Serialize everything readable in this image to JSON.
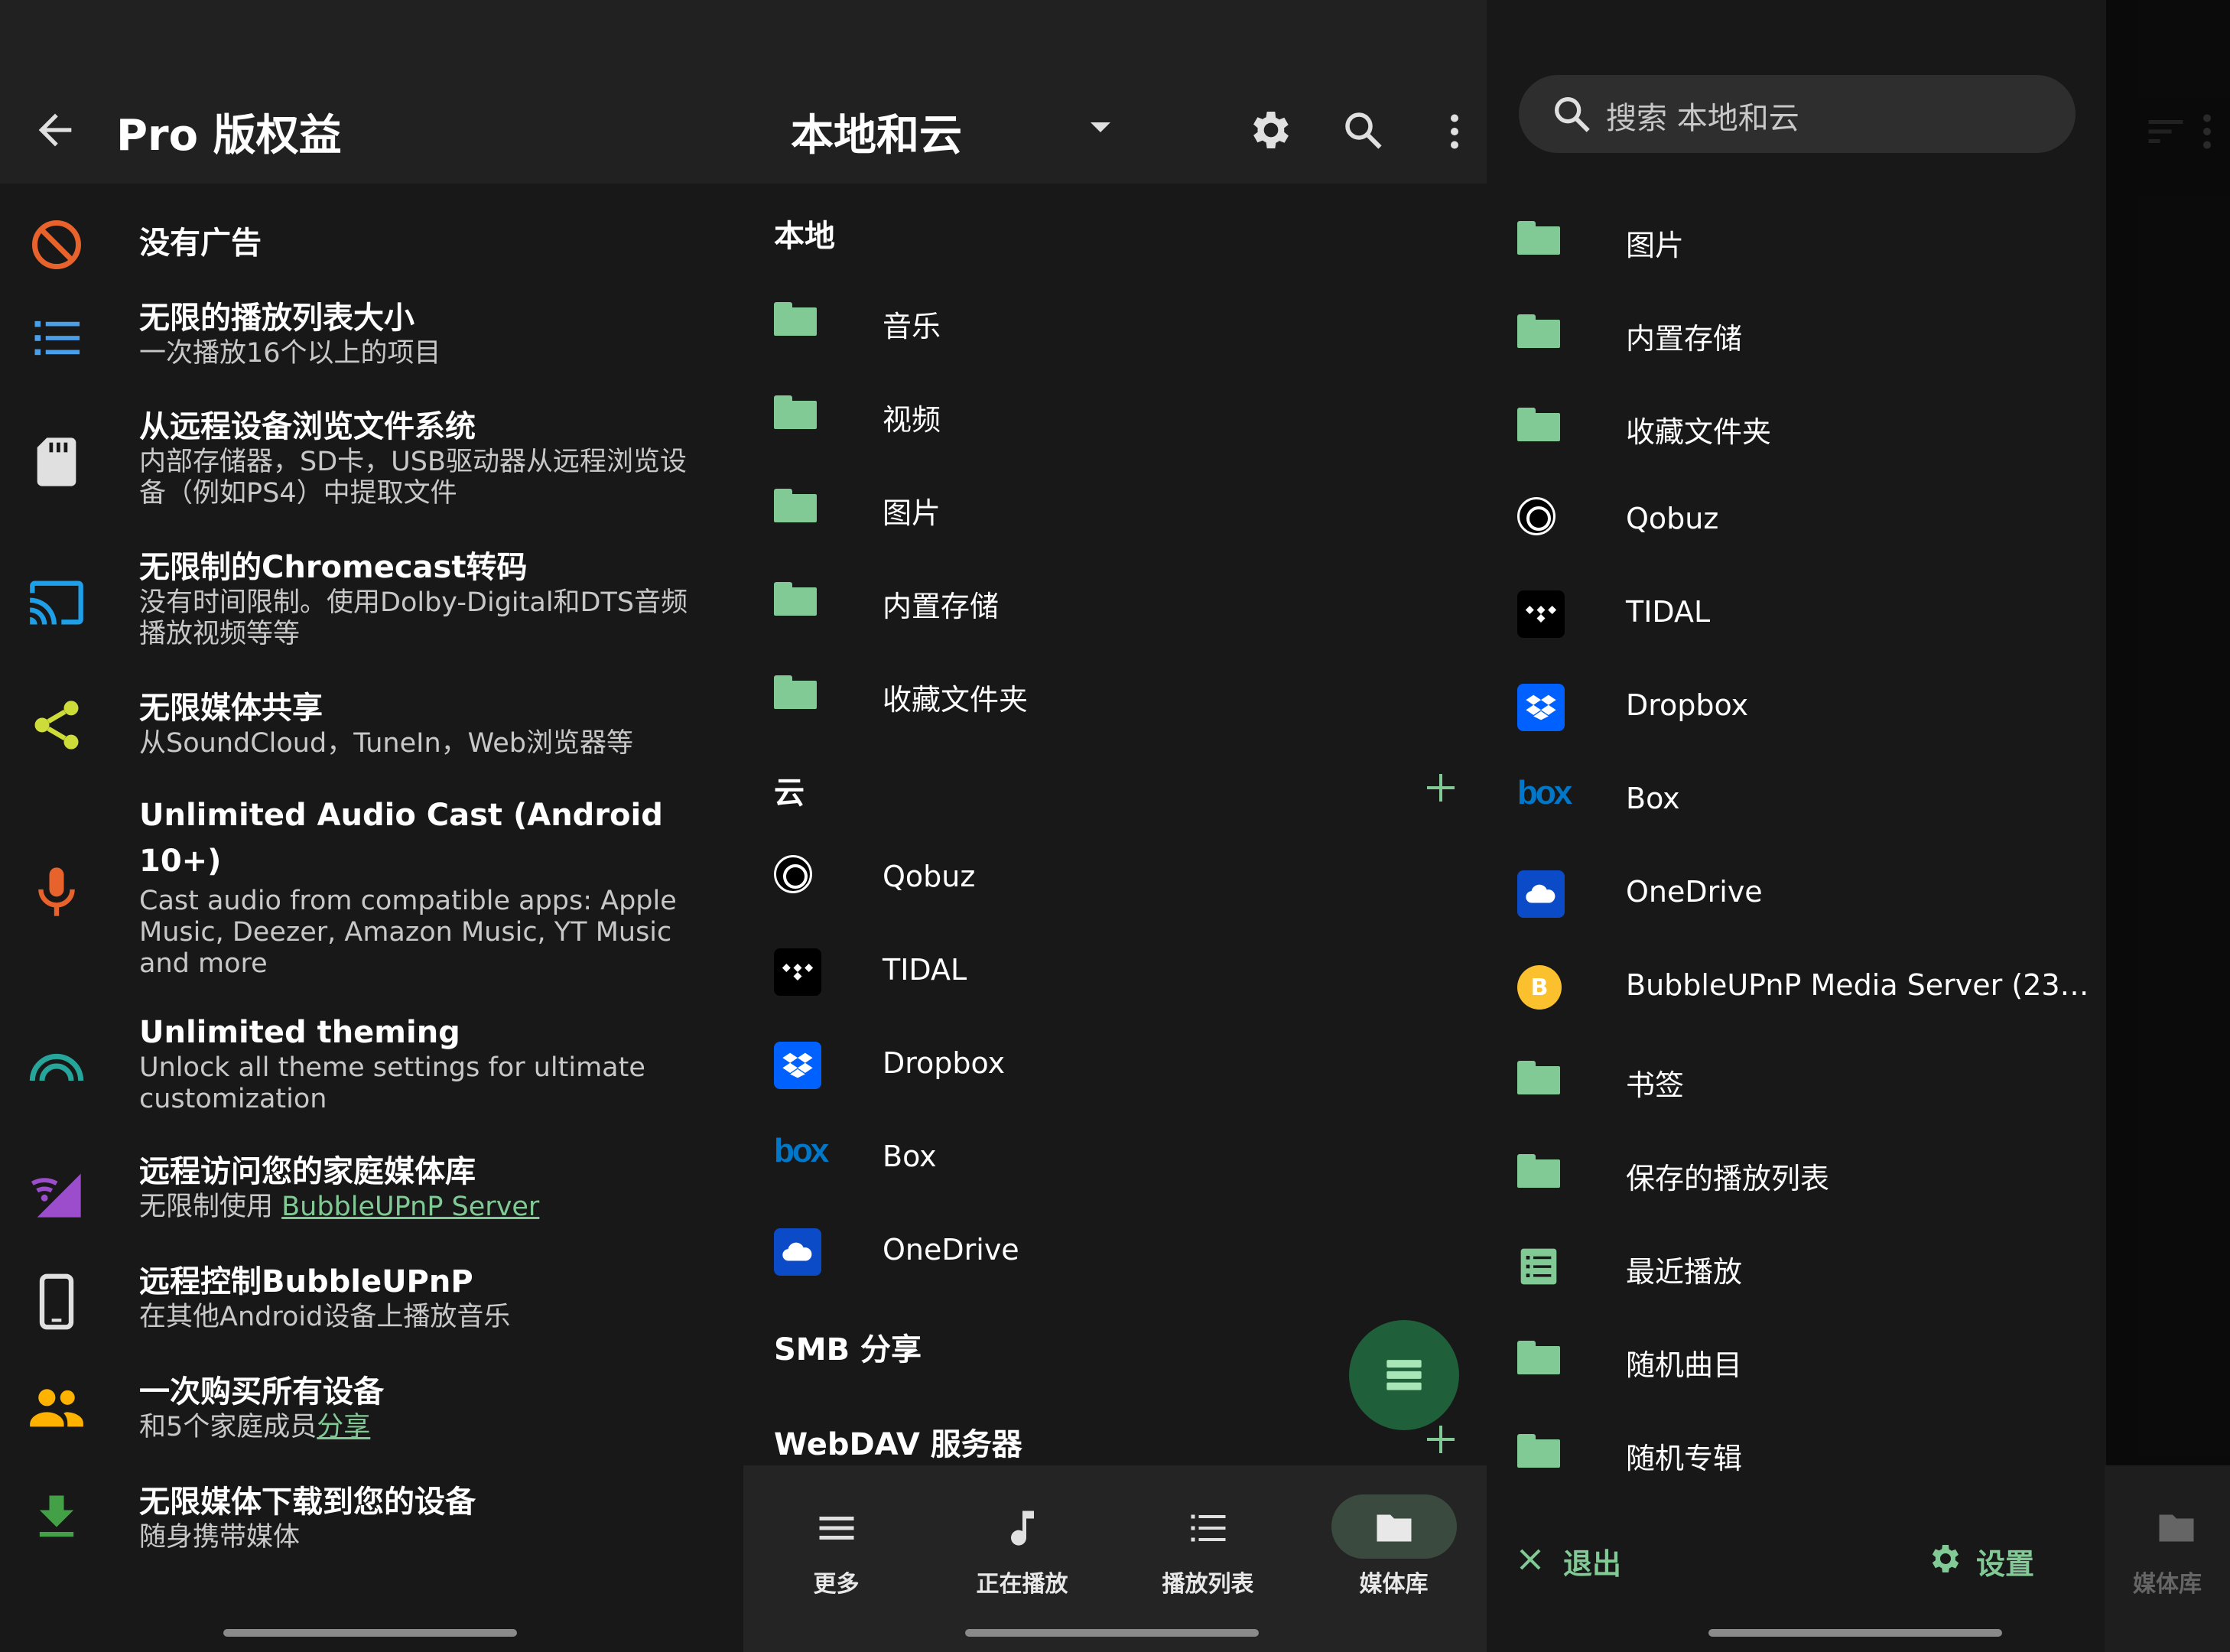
{
  "colors": {
    "accent": "#81c995",
    "bg": "#181818",
    "appbar": "#212121"
  },
  "panel1": {
    "title": "Pro 版权益",
    "features": [
      {
        "icon": "block-icon",
        "title": "没有广告",
        "desc": ""
      },
      {
        "icon": "list-icon",
        "title": "无限的播放列表大小",
        "desc": "一次播放16个以上的项目"
      },
      {
        "icon": "sd-card-icon",
        "title": "从远程设备浏览文件系统",
        "desc": "内部存储器，SD卡，USB驱动器从远程浏览设备（例如PS4）中提取文件"
      },
      {
        "icon": "cast-icon",
        "title": "无限制的Chromecast转码",
        "desc": "没有时间限制。使用Dolby-Digital和DTS音频播放视频等等"
      },
      {
        "icon": "share-icon",
        "title": "无限媒体共享",
        "desc": "从SoundCloud，TuneIn，Web浏览器等"
      },
      {
        "icon": "mic-icon",
        "title": "Unlimited Audio Cast (Android 10+)",
        "desc": "Cast audio from compatible apps: Apple Music, Deezer, Amazon Music, YT Music and more"
      },
      {
        "icon": "rainbow-icon",
        "title": "Unlimited theming",
        "desc": "Unlock all theme settings for ultimate customization"
      },
      {
        "icon": "wifi-signal-icon",
        "title": "远程访问您的家庭媒体库",
        "desc": "无限制使用 ",
        "link": "BubbleUPnP Server"
      },
      {
        "icon": "phone-icon",
        "title": "远程控制BubbleUPnP",
        "desc": "在其他Android设备上播放音乐"
      },
      {
        "icon": "people-icon",
        "title": "一次购买所有设备",
        "desc": "和5个家庭成员",
        "link": "分享"
      },
      {
        "icon": "download-icon",
        "title": "无限媒体下载到您的设备",
        "desc": "随身携带媒体"
      }
    ]
  },
  "panel2": {
    "title": "本地和云",
    "sections": {
      "local": "本地",
      "cloud": "云",
      "smb": "SMB 分享",
      "webdav": "WebDAV 服务器"
    },
    "local_items": [
      "音乐",
      "视频",
      "图片",
      "内置存储",
      "收藏文件夹"
    ],
    "cloud_items": [
      "Qobuz",
      "TIDAL",
      "Dropbox",
      "Box",
      "OneDrive"
    ],
    "nav": [
      "更多",
      "正在播放",
      "播放列表",
      "媒体库"
    ]
  },
  "panel3": {
    "search_placeholder": "搜索 本地和云",
    "items": [
      "图片",
      "内置存储",
      "收藏文件夹",
      "Qobuz",
      "TIDAL",
      "Dropbox",
      "Box",
      "OneDrive",
      "BubbleUPnP Media Server (23…",
      "书签",
      "保存的播放列表",
      "最近播放",
      "随机曲目",
      "随机专辑"
    ],
    "box_logo": "box",
    "bubble_logo": "B",
    "exit": "退出",
    "settings": "设置",
    "nav_partial": "媒体库"
  }
}
